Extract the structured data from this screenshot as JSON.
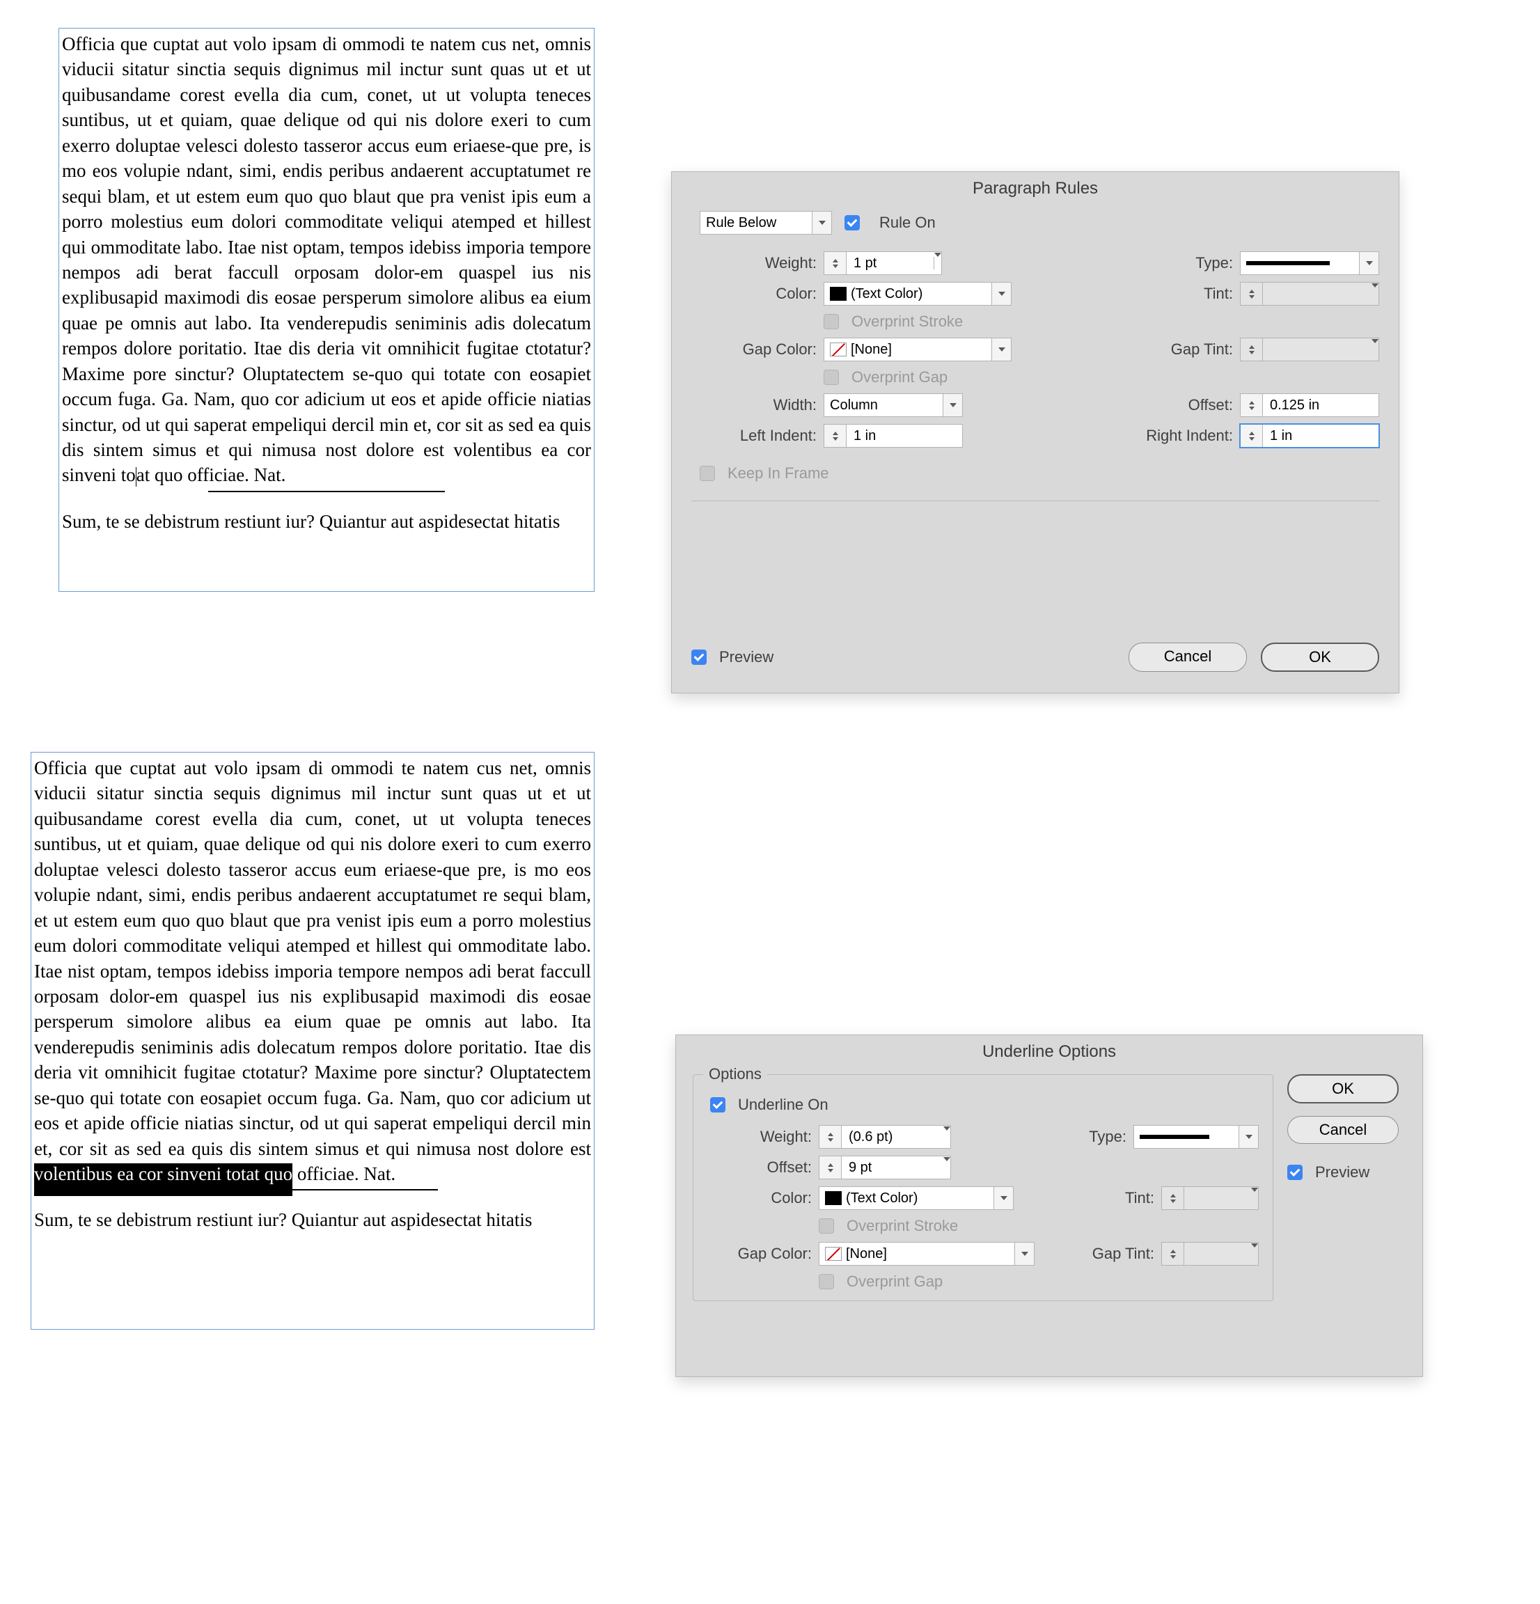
{
  "frame1": {
    "para1a": "Officia que cuptat aut volo ipsam di ommodi te natem cus net, omnis viducii sitatur sinctia sequis dignimus mil inctur sunt quas ut et ut quibusandame corest evella dia cum, conet, ut ut volupta teneces suntibus, ut et quiam, quae delique od qui nis dolore exeri to cum exerro doluptae velesci dolesto tasseror accus eum eriaese-que pre, is mo eos volupie ndant, simi, endis peribus andaerent accuptatumet re sequi blam, et ut estem eum quo quo blaut que pra venist ipis eum a porro molestius eum dolori commoditate veliqui atemped et hillest qui ommoditate labo. Itae nist optam, tempos idebiss imporia tempore nempos adi berat faccull orposam dolor-em quaspel ius nis explibusapid maximodi dis eosae persperum simolore alibus ea eium quae pe omnis aut labo. Ita venderepudis seniminis adis dolecatum rempos dolore poritatio. Itae dis deria vit omnihicit fugitae ctotatur? Maxime pore sinctur? Oluptatectem se-quo qui totate con eosapiet occum fuga. Ga. Nam, quo cor adicium ut eos et apide officie niatias sinctur, od ut qui saperat empeliqui dercil min et, cor sit as sed ea quis dis sintem simus et qui nimusa nost dolore est volentibus ea cor sinveni to",
    "para1b": "at quo officiae. Nat.",
    "para2": "Sum, te se debistrum restiunt iur? Quiantur aut aspidesectat hitatis"
  },
  "frame2": {
    "para1a": "Officia que cuptat aut volo ipsam di ommodi te natem cus net, omnis viducii sitatur sinctia sequis dignimus mil inctur sunt quas ut et ut quibusandame corest evella dia cum, conet, ut ut volupta teneces suntibus, ut et quiam, quae delique od qui nis dolore exeri to cum exerro doluptae velesci dolesto tasseror accus eum eriaese-que pre, is mo eos volupie ndant, simi, endis peribus andaerent accuptatumet re sequi blam, et ut estem eum quo quo blaut que pra venist ipis eum a porro molestius eum dolori commoditate veliqui atemped et hillest qui ommoditate labo. Itae nist optam, tempos idebiss imporia tempore nempos adi berat faccull orposam dolor-em quaspel ius nis explibusapid maximodi dis eosae persperum simolore alibus ea eium quae pe omnis aut labo. Ita venderepudis seniminis adis dolecatum rempos dolore poritatio. Itae dis deria vit omnihicit fugitae ctotatur? Maxime pore sinctur? Oluptatectem se-quo qui totate con eosapiet occum fuga. Ga. Nam, quo cor adicium ut eos et apide officie niatias sinctur, od ut qui saperat empeliqui dercil min et, cor sit as sed ea quis dis sintem simus et qui nimusa nost dolore est ",
    "highlight": "volentibus ea cor sinveni totat quo",
    "para1b": " officiae. Nat.",
    "para2": "Sum, te se debistrum restiunt iur? Quiantur aut aspidesectat hitatis"
  },
  "dialog1": {
    "title": "Paragraph Rules",
    "rule_position": "Rule Below",
    "rule_on_label": "Rule On",
    "labels": {
      "weight": "Weight:",
      "type": "Type:",
      "color": "Color:",
      "tint": "Tint:",
      "overprint_stroke": "Overprint Stroke",
      "gap_color": "Gap Color:",
      "gap_tint": "Gap Tint:",
      "overprint_gap": "Overprint Gap",
      "width": "Width:",
      "offset": "Offset:",
      "left_indent": "Left Indent:",
      "right_indent": "Right Indent:",
      "keep_in_frame": "Keep In Frame",
      "preview": "Preview"
    },
    "values": {
      "weight": "1 pt",
      "color": "(Text Color)",
      "tint": "",
      "gap_color": "[None]",
      "gap_tint": "",
      "width": "Column",
      "offset": "0.125 in",
      "left_indent": "1 in",
      "right_indent": "1 in"
    },
    "buttons": {
      "cancel": "Cancel",
      "ok": "OK"
    }
  },
  "dialog2": {
    "title": "Underline Options",
    "panel_label": "Options",
    "underline_on": "Underline On",
    "labels": {
      "weight": "Weight:",
      "type": "Type:",
      "offset": "Offset:",
      "color": "Color:",
      "tint": "Tint:",
      "overprint_stroke": "Overprint Stroke",
      "gap_color": "Gap Color:",
      "gap_tint": "Gap Tint:",
      "overprint_gap": "Overprint Gap"
    },
    "values": {
      "weight": "(0.6 pt)",
      "offset": "9 pt",
      "color": "(Text Color)",
      "tint": "",
      "gap_color": "[None]",
      "gap_tint": ""
    },
    "buttons": {
      "ok": "OK",
      "cancel": "Cancel"
    },
    "preview": "Preview"
  }
}
